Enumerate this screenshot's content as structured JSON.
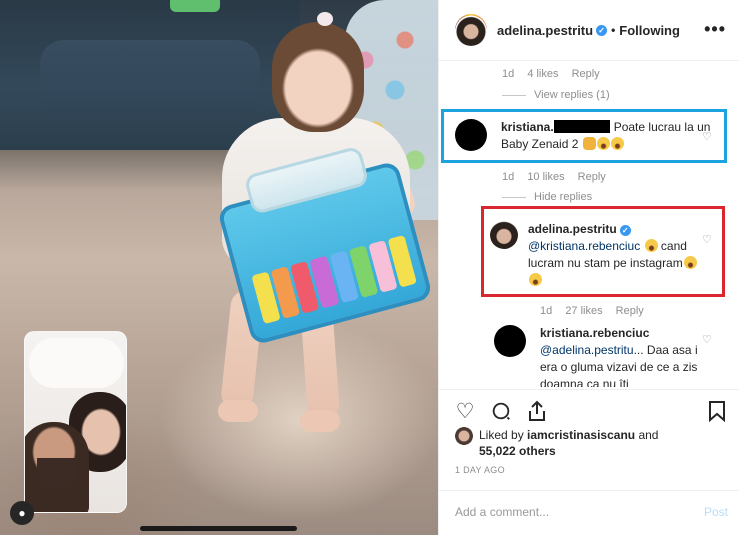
{
  "header": {
    "username": "adelina.pestritu",
    "verified_mark": "✓",
    "separator": "•",
    "follow_status": "Following",
    "more_icon": "•••"
  },
  "comments": {
    "top_meta": {
      "age": "1d",
      "likes": "4 likes",
      "reply": "Reply"
    },
    "view_replies_1": "View replies (1)",
    "c1": {
      "username": "kristiana.",
      "text": "Poate lucrau la un Baby Zenaid 2",
      "meta": {
        "age": "1d",
        "likes": "10 likes",
        "reply": "Reply"
      }
    },
    "hide_replies": "Hide replies",
    "c2": {
      "username": "adelina.pestritu",
      "mention": "@kristiana.rebenciuc",
      "text": "cand lucram nu stam pe instagram",
      "meta": {
        "age": "1d",
        "likes": "27 likes",
        "reply": "Reply"
      }
    },
    "c3": {
      "username": "kristiana.rebenciuc",
      "mention": "@adelina.pestritu",
      "text": "... Daa asa i era o gluma vizavi de ce a zis doamna ca nu îti"
    }
  },
  "actions": {
    "like_icon": "heart-outline",
    "comment_icon": "speech-bubble",
    "share_icon": "share-arrow",
    "save_icon": "bookmark"
  },
  "likes": {
    "prefix": "Liked by",
    "user": "iamcristinasiscanu",
    "and": "and",
    "count": "55,022 others"
  },
  "timestamp": "1 DAY AGO",
  "add_comment": {
    "placeholder": "Add a comment...",
    "post_label": "Post"
  },
  "colors": {
    "highlight_blue": "#1ca3dd",
    "highlight_red": "#d9262f",
    "verified": "#3897f0",
    "post_disabled": "#b2dffc"
  }
}
